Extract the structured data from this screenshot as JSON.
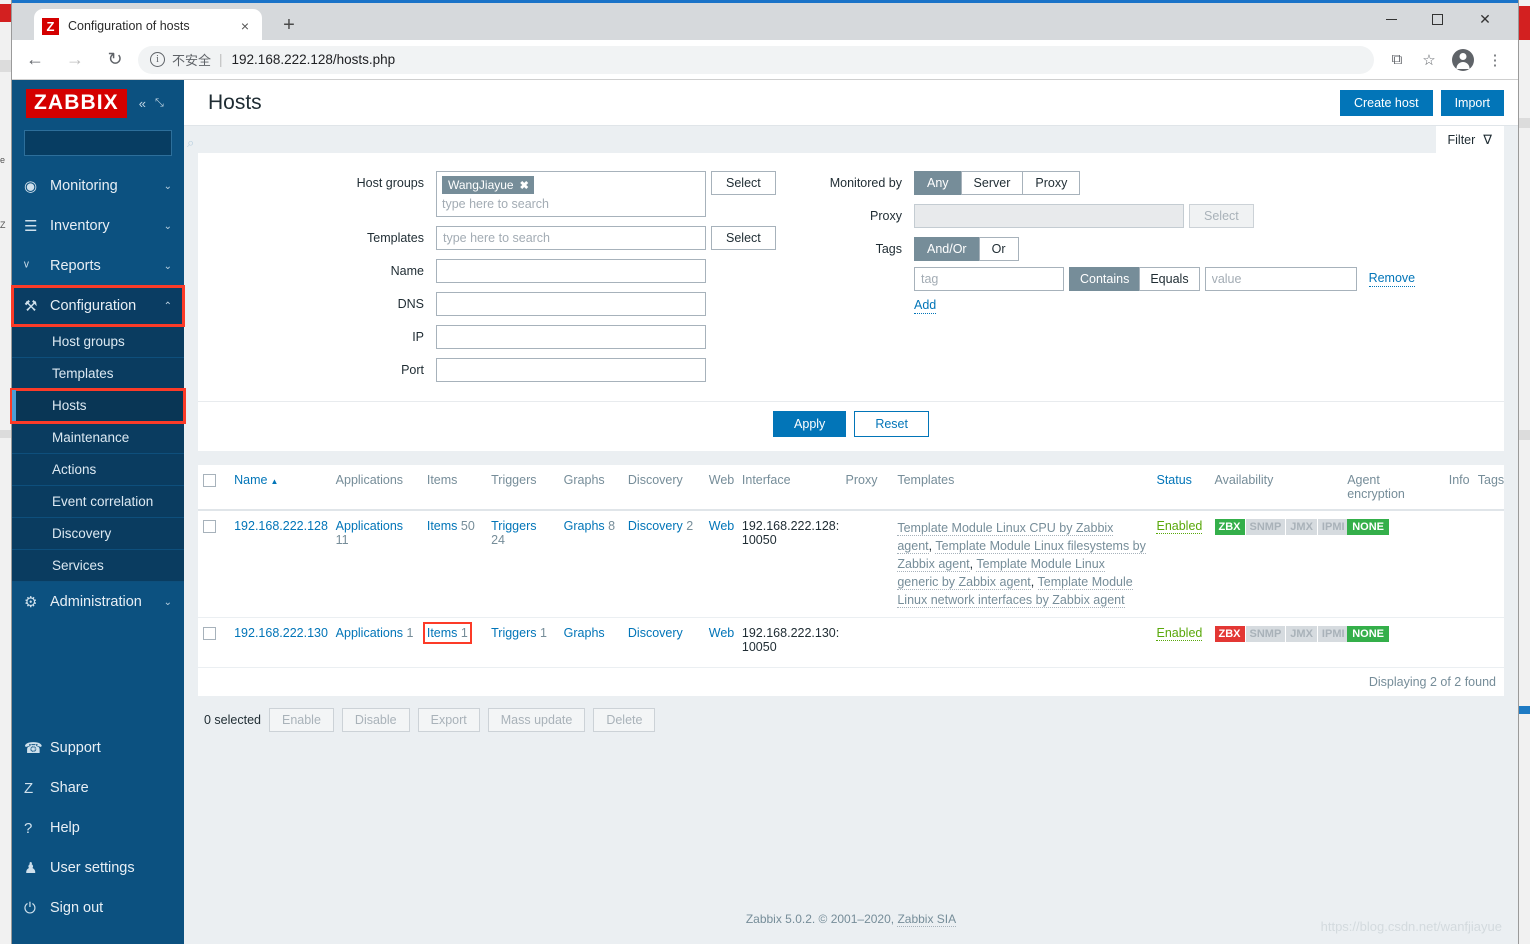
{
  "browser": {
    "tab_title": "Configuration of hosts",
    "favicon_letter": "Z",
    "tab_close": "×",
    "new_tab": "+",
    "back": "←",
    "forward": "→",
    "reload": "↻",
    "info_glyph": "i",
    "not_secure": "不安全",
    "separator": "|",
    "url": "192.168.222.128/hosts.php",
    "translate_icon": "⧉",
    "star_icon": "☆",
    "menu_icon": "⋮",
    "win_close": "✕"
  },
  "sidebar": {
    "logo": "ZABBIX",
    "collapse_icon": "«",
    "hide_icon": "⤡",
    "search_placeholder": "",
    "search_value": "",
    "search_icon": "⌕",
    "nav": [
      {
        "label": "Monitoring",
        "icon": "◉",
        "chevron": "⌄",
        "state": "collapsed"
      },
      {
        "label": "Inventory",
        "icon": "☰",
        "chevron": "⌄",
        "state": "collapsed"
      },
      {
        "label": "Reports",
        "icon": "ᵛ",
        "chevron": "⌄",
        "state": "collapsed"
      },
      {
        "label": "Configuration",
        "icon": "⚒",
        "chevron": "⌃",
        "state": "expanded"
      }
    ],
    "config_submenu": [
      {
        "label": "Host groups"
      },
      {
        "label": "Templates"
      },
      {
        "label": "Hosts"
      },
      {
        "label": "Maintenance"
      },
      {
        "label": "Actions"
      },
      {
        "label": "Event correlation"
      },
      {
        "label": "Discovery"
      },
      {
        "label": "Services"
      }
    ],
    "selected_submenu": "Hosts",
    "administration": {
      "label": "Administration",
      "icon": "⚙",
      "chevron": "⌄"
    },
    "bottom": [
      {
        "label": "Support",
        "icon": "☎"
      },
      {
        "label": "Share",
        "icon": "Z"
      },
      {
        "label": "Help",
        "icon": "?"
      },
      {
        "label": "User settings",
        "icon": "♟"
      },
      {
        "label": "Sign out",
        "icon": "⏻"
      }
    ]
  },
  "header": {
    "title": "Hosts",
    "create_host": "Create host",
    "import": "Import"
  },
  "filter_tab": {
    "label": "Filter",
    "icon": "∇"
  },
  "filter": {
    "host_groups": {
      "label": "Host groups",
      "chips": [
        "WangJiayue"
      ],
      "chip_remove": "✖",
      "placeholder": "type here to search",
      "select_button": "Select"
    },
    "templates": {
      "label": "Templates",
      "value": "",
      "placeholder": "type here to search",
      "select_button": "Select"
    },
    "name": {
      "label": "Name",
      "value": "",
      "placeholder": ""
    },
    "dns": {
      "label": "DNS",
      "value": "",
      "placeholder": ""
    },
    "ip": {
      "label": "IP",
      "value": "",
      "placeholder": ""
    },
    "port": {
      "label": "Port",
      "value": "",
      "placeholder": ""
    },
    "monitored_by": {
      "label": "Monitored by",
      "options": [
        "Any",
        "Server",
        "Proxy"
      ],
      "selected": "Any"
    },
    "proxy": {
      "label": "Proxy",
      "value": "",
      "placeholder": "",
      "select_button": "Select",
      "disabled": true
    },
    "tags": {
      "label": "Tags",
      "operator_options": [
        "And/Or",
        "Or"
      ],
      "operator_selected": "And/Or",
      "rows": [
        {
          "tag_placeholder": "tag",
          "tag_value": "",
          "match_options": [
            "Contains",
            "Equals"
          ],
          "match_selected": "Contains",
          "value_placeholder": "value",
          "value_value": "",
          "remove_label": "Remove"
        }
      ],
      "add_label": "Add"
    },
    "apply": "Apply",
    "reset": "Reset"
  },
  "table": {
    "sort_arrow": "▲",
    "columns": [
      "",
      "Name",
      "Applications",
      "Items",
      "Triggers",
      "Graphs",
      "Discovery",
      "Web",
      "Interface",
      "Proxy",
      "Templates",
      "Status",
      "Availability",
      "Agent encryption",
      "Info",
      "Tags"
    ],
    "rows": [
      {
        "name": "192.168.222.128",
        "applications": {
          "label": "Applications",
          "count": "11"
        },
        "items": {
          "label": "Items",
          "count": "50",
          "highlighted": false
        },
        "triggers": {
          "label": "Triggers",
          "count": "24"
        },
        "graphs": {
          "label": "Graphs",
          "count": "8"
        },
        "discovery": {
          "label": "Discovery",
          "count": "2"
        },
        "web": {
          "label": "Web",
          "count": ""
        },
        "interface": "192.168.222.128: 10050",
        "proxy": "",
        "templates": [
          "Template Module Linux CPU by Zabbix agent",
          "Template Module Linux filesystems by Zabbix agent",
          "Template Module Linux generic by Zabbix agent",
          "Template Module Linux network interfaces by Zabbix agent"
        ],
        "status": "Enabled",
        "availability": [
          {
            "label": "ZBX",
            "state": "green"
          },
          {
            "label": "SNMP",
            "state": "off"
          },
          {
            "label": "JMX",
            "state": "off"
          },
          {
            "label": "IPMI",
            "state": "off"
          }
        ],
        "agent_encryption": "NONE",
        "info": "",
        "tags": ""
      },
      {
        "name": "192.168.222.130",
        "applications": {
          "label": "Applications",
          "count": "1"
        },
        "items": {
          "label": "Items",
          "count": "1",
          "highlighted": true
        },
        "triggers": {
          "label": "Triggers",
          "count": "1"
        },
        "graphs": {
          "label": "Graphs",
          "count": ""
        },
        "discovery": {
          "label": "Discovery",
          "count": ""
        },
        "web": {
          "label": "Web",
          "count": ""
        },
        "interface": "192.168.222.130: 10050",
        "proxy": "",
        "templates": [],
        "status": "Enabled",
        "availability": [
          {
            "label": "ZBX",
            "state": "red"
          },
          {
            "label": "SNMP",
            "state": "off"
          },
          {
            "label": "JMX",
            "state": "off"
          },
          {
            "label": "IPMI",
            "state": "off"
          }
        ],
        "agent_encryption": "NONE",
        "info": "",
        "tags": ""
      }
    ],
    "displaying": "Displaying 2 of 2 found"
  },
  "action_bar": {
    "selected_text": "0 selected",
    "buttons": [
      "Enable",
      "Disable",
      "Export",
      "Mass update",
      "Delete"
    ]
  },
  "footer": {
    "text": "Zabbix 5.0.2. © 2001–2020, ",
    "link": "Zabbix SIA",
    "watermark": "https://blog.csdn.net/wanfjiayue"
  }
}
